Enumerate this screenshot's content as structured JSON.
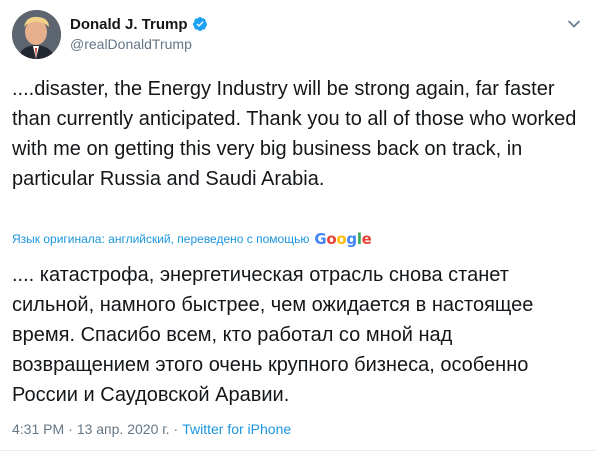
{
  "user": {
    "display_name": "Donald J. Trump",
    "handle": "@realDonaldTrump",
    "verified_icon": "verified-badge-icon",
    "avatar_icon": "profile-photo"
  },
  "tweet": {
    "text": "....disaster, the Energy Industry will be strong again, far faster than currently anticipated. Thank you to all of those who worked with me on getting this very big business back on track, in particular Russia and Saudi Arabia."
  },
  "translation": {
    "label": "Язык оригинала: английский, переведено с помощью",
    "provider": "Google",
    "text": ".... катастрофа, энергетическая отрасль снова станет сильной, намного быстрее, чем ожидается в настоящее время. Спасибо всем, кто работал со мной над возвращением этого очень крупного бизнеса, особенно России и Саудовской Аравии."
  },
  "meta": {
    "time": "4:31 PM",
    "separator": "·",
    "date": "13 апр. 2020 г.",
    "source": "Twitter for iPhone"
  },
  "colors": {
    "accent": "#1b95e0",
    "muted": "#657786",
    "text": "#14171a"
  }
}
